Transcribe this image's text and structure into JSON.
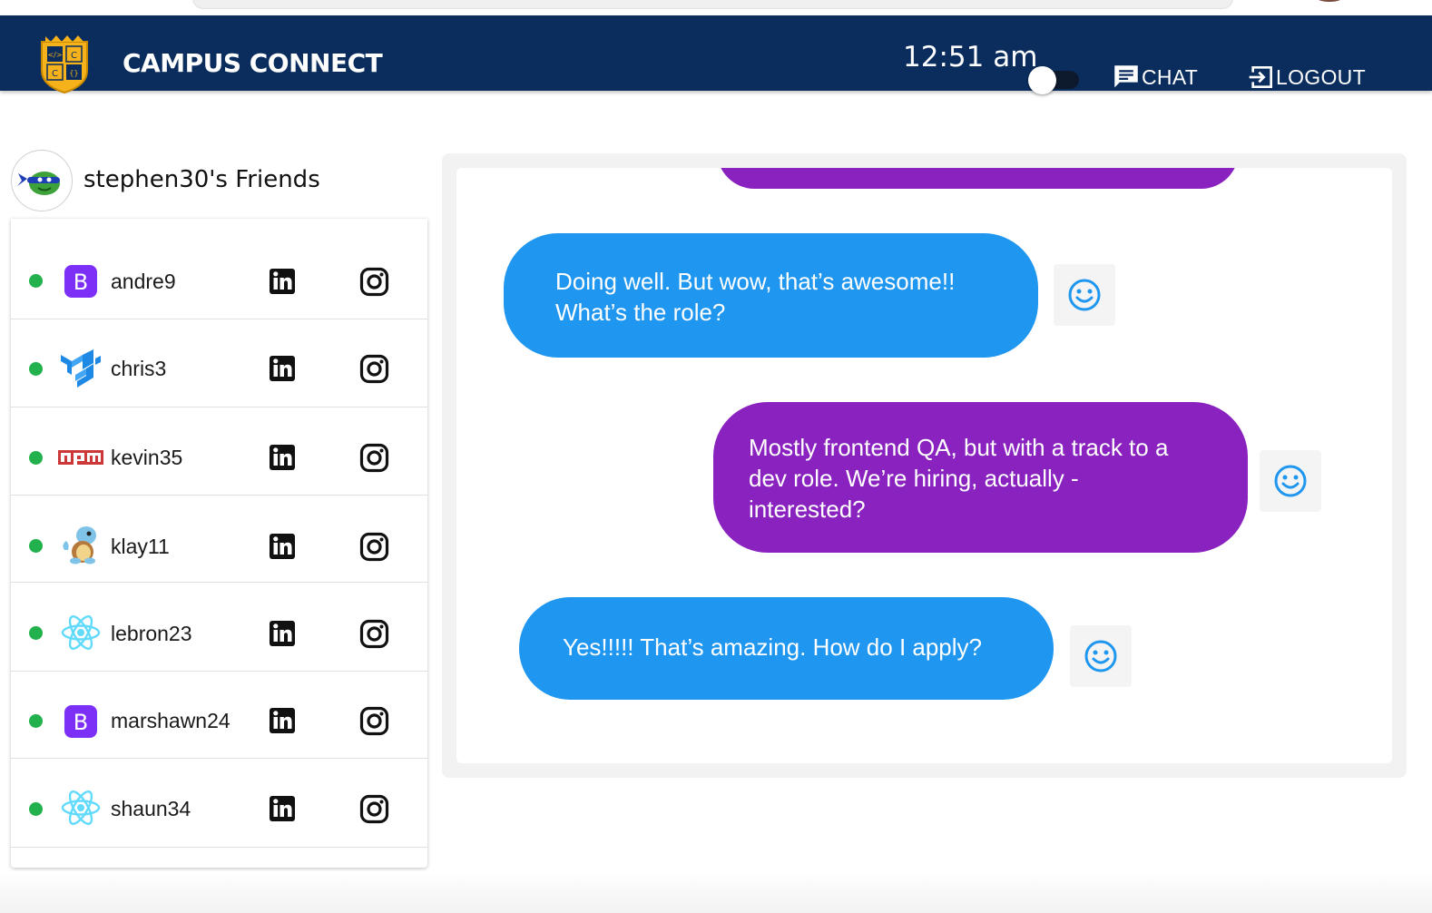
{
  "header": {
    "brand": "CAMPUS CONNECT",
    "clock": "12:51 am",
    "chat_label": "CHAT",
    "logout_label": "LOGOUT"
  },
  "friends": {
    "title": "stephen30's Friends",
    "items": [
      {
        "name": "andre9",
        "avatar": "bootstrap-icon",
        "online": true
      },
      {
        "name": "chris3",
        "avatar": "material-ui-icon",
        "online": true
      },
      {
        "name": "kevin35",
        "avatar": "npm-icon",
        "online": true
      },
      {
        "name": "klay11",
        "avatar": "squirtle-icon",
        "online": true
      },
      {
        "name": "lebron23",
        "avatar": "react-icon",
        "online": true
      },
      {
        "name": "marshawn24",
        "avatar": "bootstrap-icon",
        "online": true
      },
      {
        "name": "shaun34",
        "avatar": "react-icon",
        "online": true
      }
    ]
  },
  "chat": {
    "messages": [
      {
        "sender": "other",
        "text_lines": [
          "Doing well. But wow, that’s awesome!!",
          "What’s the role?"
        ]
      },
      {
        "sender": "self",
        "text_lines": [
          "Mostly frontend QA, but with a track to a",
          "dev role. We’re hiring, actually  -",
          "interested?"
        ]
      },
      {
        "sender": "other",
        "text_lines": [
          "Yes!!!!! That’s amazing. How do I apply?"
        ]
      }
    ]
  },
  "colors": {
    "topbar": "#0a2d5e",
    "online": "#22b14c",
    "bubble_blue": "#1f96ef",
    "bubble_purple": "#8a22c0"
  }
}
